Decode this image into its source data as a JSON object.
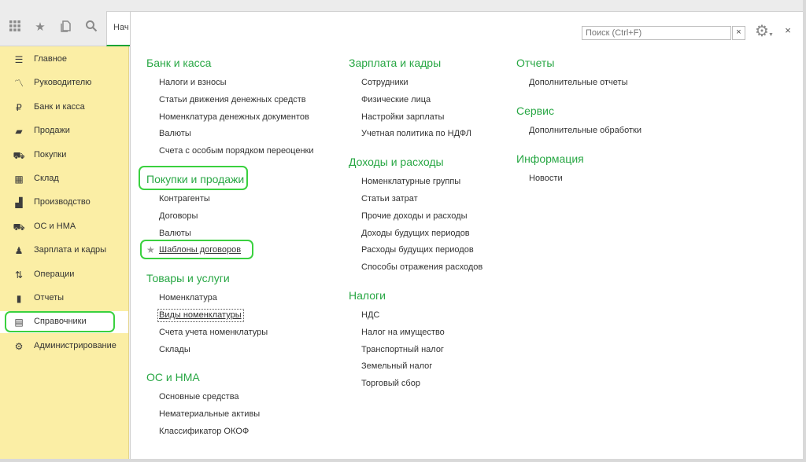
{
  "toolbar": {
    "icons": [
      "apps-grid-icon",
      "favorites-star-icon",
      "history-icon",
      "search-icon"
    ],
    "tab_label": "Нач"
  },
  "sidebar": {
    "items": [
      {
        "label": "Главное",
        "icon": "menu-lines-icon"
      },
      {
        "label": "Руководителю",
        "icon": "trend-chart-icon"
      },
      {
        "label": "Банк и касса",
        "icon": "ruble-coin-icon"
      },
      {
        "label": "Продажи",
        "icon": "shopping-bag-icon"
      },
      {
        "label": "Покупки",
        "icon": "shopping-cart-icon"
      },
      {
        "label": "Склад",
        "icon": "warehouse-boxes-icon"
      },
      {
        "label": "Производство",
        "icon": "factory-icon"
      },
      {
        "label": "ОС и НМА",
        "icon": "truck-icon"
      },
      {
        "label": "Зарплата и кадры",
        "icon": "person-icon"
      },
      {
        "label": "Операции",
        "icon": "operations-icon"
      },
      {
        "label": "Отчеты",
        "icon": "bar-chart-icon"
      },
      {
        "label": "Справочники",
        "icon": "reference-books-icon"
      },
      {
        "label": "Администрирование",
        "icon": "gear-icon"
      }
    ],
    "active_index": 11
  },
  "panel": {
    "search_placeholder": "Поиск (Ctrl+F)",
    "search_clear": "×",
    "close": "×",
    "columns": [
      {
        "sections": [
          {
            "title": "Банк и касса",
            "links": [
              "Налоги и взносы",
              "Статьи движения денежных средств",
              "Номенклатура денежных документов",
              "Валюты",
              "Счета с особым порядком переоценки"
            ]
          },
          {
            "title": "Покупки и продажи",
            "links": [
              "Контрагенты",
              "Договоры",
              "Валюты",
              "Шаблоны договоров"
            ]
          },
          {
            "title": "Товары и услуги",
            "links": [
              "Номенклатура",
              "Виды номенклатуры",
              "Счета учета номенклатуры",
              "Склады"
            ]
          },
          {
            "title": "ОС и НМА",
            "links": [
              "Основные средства",
              "Нематериальные активы",
              "Классификатор ОКОФ"
            ]
          }
        ]
      },
      {
        "sections": [
          {
            "title": "Зарплата и кадры",
            "links": [
              "Сотрудники",
              "Физические лица",
              "Настройки зарплаты",
              "Учетная политика по НДФЛ"
            ]
          },
          {
            "title": "Доходы и расходы",
            "links": [
              "Номенклатурные группы",
              "Статьи затрат",
              "Прочие доходы и расходы",
              "Доходы будущих периодов",
              "Расходы будущих периодов",
              "Способы отражения расходов"
            ]
          },
          {
            "title": "Налоги",
            "links": [
              "НДС",
              "Налог на имущество",
              "Транспортный налог",
              "Земельный налог",
              "Торговый сбор"
            ]
          }
        ]
      },
      {
        "sections": [
          {
            "title": "Отчеты",
            "links": [
              "Дополнительные отчеты"
            ]
          },
          {
            "title": "Сервис",
            "links": [
              "Дополнительные обработки"
            ]
          },
          {
            "title": "Информация",
            "links": [
              "Новости"
            ]
          }
        ]
      }
    ]
  },
  "colors": {
    "accent": "#28a744",
    "sidebar_bg": "#fbeea5",
    "highlight": "#3ad13f"
  }
}
